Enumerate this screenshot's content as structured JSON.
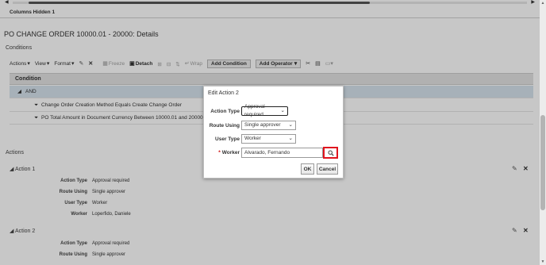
{
  "columns_hidden": "Columns Hidden  1",
  "page_title": "PO CHANGE ORDER 10000.01 - 20000: Details",
  "conditions_section": "Conditions",
  "toolbar": {
    "actions": "Actions",
    "view": "View",
    "format": "Format",
    "freeze": "Freeze",
    "detach": "Detach",
    "wrap": "Wrap",
    "add_condition": "Add Condition",
    "add_operator": "Add Operator"
  },
  "table": {
    "header": "Condition",
    "rows": [
      "AND",
      "Change Order Creation Method Equals Create Change Order",
      "PO Total Amount in Document Currency Between 10000.01 and 20000"
    ]
  },
  "actions_section": "Actions",
  "actions": [
    {
      "title": "Action 1",
      "fields": [
        {
          "label": "Action Type",
          "value": "Approval required"
        },
        {
          "label": "Route Using",
          "value": "Single approver"
        },
        {
          "label": "User Type",
          "value": "Worker"
        },
        {
          "label": "Worker",
          "value": "Loperfido, Daniele"
        }
      ]
    },
    {
      "title": "Action 2",
      "fields": [
        {
          "label": "Action Type",
          "value": "Approval required"
        },
        {
          "label": "Route Using",
          "value": "Single approver"
        }
      ]
    }
  ],
  "dialog": {
    "title": "Edit Action 2",
    "action_type_label": "Action Type",
    "action_type_value": "Approval required",
    "route_using_label": "Route Using",
    "route_using_value": "Single approver",
    "user_type_label": "User Type",
    "user_type_value": "Worker",
    "worker_label": "Worker",
    "worker_required": "*",
    "worker_value": "Alvarado, Fernando",
    "ok": "OK",
    "cancel": "Cancel"
  },
  "colors": {
    "highlight": "#e0141e",
    "selected_row": "#d7e3ee"
  }
}
